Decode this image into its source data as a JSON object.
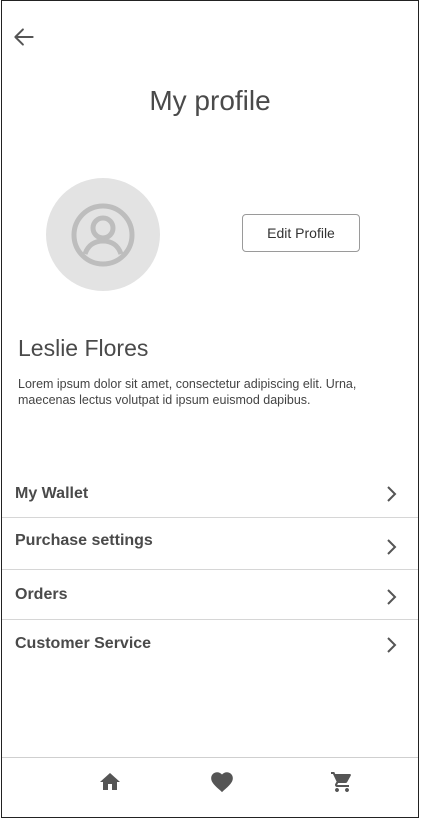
{
  "header": {
    "back_icon": "arrow-left-icon",
    "title": "My profile"
  },
  "profile": {
    "avatar_icon": "user-avatar-icon",
    "edit_label": "Edit Profile",
    "name": "Leslie Flores",
    "bio": "Lorem ipsum dolor sit amet, consectetur adipiscing elit. Urna, maecenas lectus volutpat id ipsum euismod dapibus."
  },
  "menu": {
    "items": [
      {
        "label": "My Wallet"
      },
      {
        "label": "Purchase settings"
      },
      {
        "label": "Orders"
      },
      {
        "label": "Customer Service"
      }
    ],
    "chevron_icon": "chevron-right-icon"
  },
  "tabbar": {
    "icons": [
      "home-icon",
      "heart-icon",
      "cart-icon"
    ],
    "icon_color": "#555555"
  }
}
